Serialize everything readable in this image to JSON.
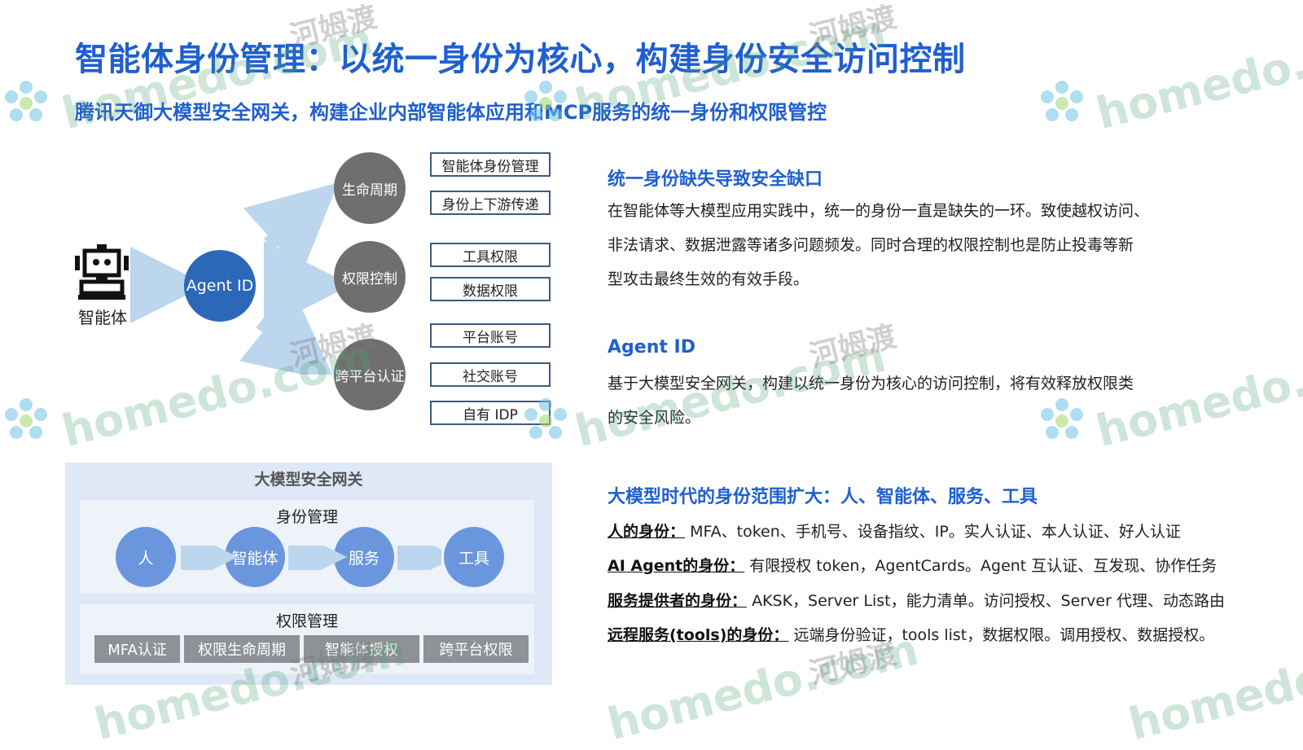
{
  "title": "智能体身份管理：以统一身份为核心，构建身份安全访问控制",
  "subtitle": "腾讯天御大模型安全网关，构建企业内部智能体应用和MCP服务的统一身份和权限管控",
  "diagram": {
    "agent_label": "智能体",
    "agent_id": "Agent ID",
    "nodes": {
      "lifecycle": "生命周期",
      "permission": "权限控制",
      "cross_platform": "跨平台认证"
    },
    "boxes": {
      "lifecycle": [
        "智能体身份管理",
        "身份上下游传递"
      ],
      "permission": [
        "工具权限",
        "数据权限"
      ],
      "cross_platform": [
        "平台账号",
        "社交账号",
        "自有 IDP"
      ]
    }
  },
  "gateway": {
    "title": "大模型安全网关",
    "identity_title": "身份管理",
    "identity_items": [
      "人",
      "智能体",
      "服务",
      "工具"
    ],
    "permission_title": "权限管理",
    "permission_items": [
      "MFA认证",
      "权限生命周期",
      "智能体授权",
      "跨平台权限"
    ]
  },
  "sections": {
    "gap": {
      "heading": "统一身份缺失导致安全缺口",
      "lines": [
        "在智能体等大模型应用实践中，统一的身份一直是缺失的一环。致使越权访问、",
        "非法请求、数据泄露等诸多问题频发。同时合理的权限控制也是防止投毒等新",
        "型攻击最终生效的有效手段。"
      ]
    },
    "agent_id": {
      "heading": "Agent ID",
      "lines": [
        "基于大模型安全网关，构建以统一身份为核心的访问控制，将有效释放权限类",
        "的安全风险。"
      ]
    },
    "scope": {
      "heading": "大模型时代的身份范围扩大：人、智能体、服务、工具",
      "items": [
        {
          "label": "人的身份：",
          "text": "MFA、token、手机号、设备指纹、IP。实人认证、本人认证、好人认证"
        },
        {
          "label": "AI Agent的身份：",
          "text": "有限授权 token，AgentCards。Agent 互认证、互发现、协作任务"
        },
        {
          "label": "服务提供者的身份：",
          "text": "AKSK，Server List，能力清单。访问授权、Server 代理、动态路由"
        },
        {
          "label": "远程服务(tools)的身份：",
          "text": "远端身份验证，tools list，数据权限。调用授权、数据授权。"
        }
      ]
    }
  },
  "watermark": {
    "brand": "homedo.com",
    "cn": "河姆渡"
  },
  "colors": {
    "title_blue": "#1f5fd1",
    "agent_circle": "#2b68b7",
    "grey_circle": "#6f6f6f",
    "gateway_bg": "#dfe8f6",
    "identity_circle": "#6a96dd",
    "perm_tag": "#8e9195",
    "arrow": "#bcd6ee"
  }
}
